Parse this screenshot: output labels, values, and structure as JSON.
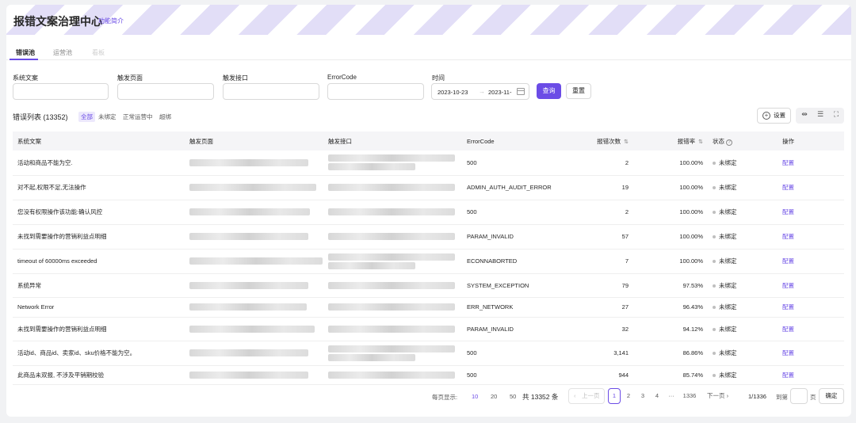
{
  "header": {
    "title": "报错文案治理中心",
    "intro_link": "功能简介"
  },
  "tabs": [
    {
      "label": "错误池",
      "state": "active"
    },
    {
      "label": "运营池",
      "state": "normal"
    },
    {
      "label": "看板",
      "state": "disabled"
    }
  ],
  "filters": {
    "labels": [
      "系统文案",
      "触发页面",
      "触发接口",
      "ErrorCode",
      "时间"
    ],
    "date_start": "2023-10-23",
    "date_sep": "→",
    "date_end": "2023-11-",
    "search_button": "查询",
    "reset_button": "重置"
  },
  "list": {
    "title": "错误列表",
    "count": "(13352)",
    "status_filters": [
      "全部",
      "未绑定",
      "正常运营中",
      "超绑"
    ],
    "settings_button": "设置"
  },
  "table": {
    "columns": [
      "系统文案",
      "触发页面",
      "触发接口",
      "ErrorCode",
      "报错次数",
      "报错率",
      "状态",
      "操作"
    ],
    "rows": [
      {
        "text": "活动和商品不能为空.",
        "page": "",
        "api": "tmall.",
        "api_tail": "mi",
        "api_tail2": "t",
        "code": "500",
        "count": "2",
        "rate": "100.00%",
        "status": "未绑定",
        "action": "配置"
      },
      {
        "text": "对不起,权限不足,无法操作",
        "page": "port...tail",
        "api": "",
        "api_tail": "",
        "api_tail2": "",
        "code": "ADMIN_AUTH_AUDIT_ERROR",
        "count": "19",
        "rate": "100.00%",
        "status": "未绑定",
        "action": "配置"
      },
      {
        "text": "您没有权限操作该功能:确认风控",
        "page": "",
        "api": "",
        "api_tail": "upon/retr",
        "api_tail2": "",
        "code": "500",
        "count": "2",
        "rate": "100.00%",
        "status": "未绑定",
        "action": "配置"
      },
      {
        "text": "未找到需要操作的营销利益点明细",
        "page": "",
        "api": "",
        "api_tail": "detail/r",
        "api_tail2": "",
        "code": "PARAM_INVALID",
        "count": "57",
        "rate": "100.00%",
        "status": "未绑定",
        "action": "配置"
      },
      {
        "text": "timeout of 60000ms exceeded",
        "page": "",
        "api": "",
        "api_tail": "qu",
        "api_tail2": "",
        "code": "ECONNABORTED",
        "count": "7",
        "rate": "100.00%",
        "status": "未绑定",
        "action": "配置"
      },
      {
        "text": "系统异常",
        "page": "",
        "api": "",
        "api_tail": "li",
        "api_tail2": "",
        "code": "SYSTEM_EXCEPTION",
        "count": "79",
        "rate": "97.53%",
        "status": "未绑定",
        "action": "配置"
      },
      {
        "text": "Network Error",
        "page": "",
        "api": "",
        "api_tail": "",
        "api_tail2": "",
        "code": "ERR_NETWORK",
        "count": "27",
        "rate": "96.43%",
        "status": "未绑定",
        "action": "配置"
      },
      {
        "text": "未找到需要操作的营销利益点明细",
        "page": "",
        "api": "",
        "api_tail": "detail/r",
        "api_tail2": "e",
        "code": "PARAM_INVALID",
        "count": "32",
        "rate": "94.12%",
        "status": "未绑定",
        "action": "配置"
      },
      {
        "text": "活动id、商品id、卖家id、sku价格不能为空。",
        "page": "",
        "api": "",
        "api_tail": "ric",
        "api_tail2": "eInfo",
        "code": "500",
        "count": "3,141",
        "rate": "86.86%",
        "status": "未绑定",
        "action": "配置"
      },
      {
        "text": "此商品未双报, 不涉及平销期校验",
        "page": "",
        "api": "",
        "api_tail": "hj",
        "api_tail2": "",
        "code": "500",
        "count": "944",
        "rate": "85.74%",
        "status": "未绑定",
        "action": "配置"
      }
    ]
  },
  "pagination": {
    "page_size_label": "每页显示:",
    "sizes": [
      "10",
      "20",
      "50"
    ],
    "total": "共 13352 条",
    "prev": "上一页",
    "pages": [
      "1",
      "2",
      "3",
      "4",
      "···",
      "1336"
    ],
    "next": "下一页",
    "current_of": "1/1336",
    "goto_label": "到第",
    "page_unit": "页",
    "confirm": "确定"
  },
  "colors": {
    "accent": "#6b4ce6"
  }
}
